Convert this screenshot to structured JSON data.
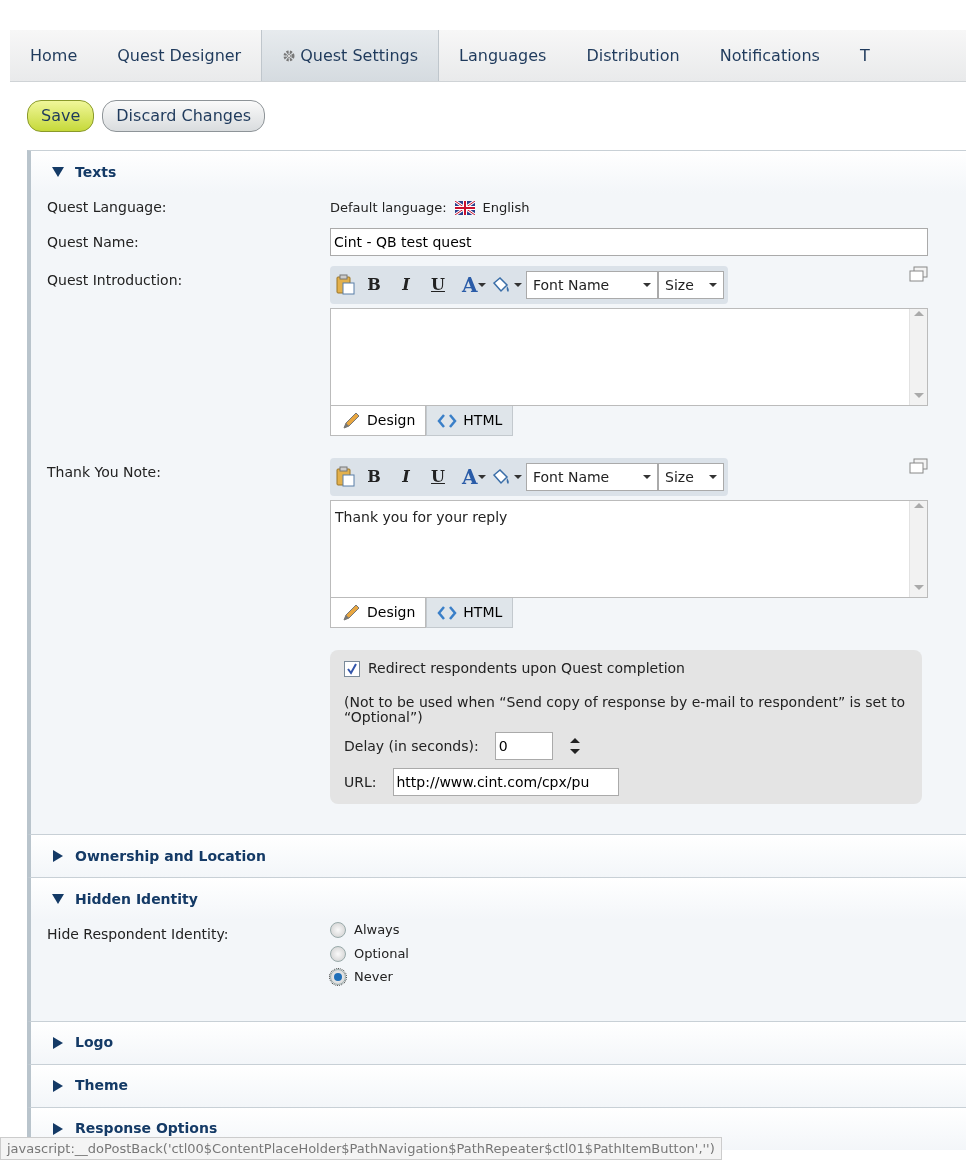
{
  "tabs": [
    {
      "label": "Home",
      "selected": false,
      "has_icon": false
    },
    {
      "label": "Quest Designer",
      "selected": false,
      "has_icon": false
    },
    {
      "label": "Quest Settings",
      "selected": true,
      "has_icon": true
    },
    {
      "label": "Languages",
      "selected": false,
      "has_icon": false
    },
    {
      "label": "Distribution",
      "selected": false,
      "has_icon": false
    },
    {
      "label": "Notifications",
      "selected": false,
      "has_icon": false
    },
    {
      "label": "T",
      "selected": false,
      "has_icon": false
    }
  ],
  "buttons": [
    {
      "label": "Save",
      "kind": "primary"
    },
    {
      "label": "Discard Changes",
      "kind": "secondary"
    }
  ],
  "sections": [
    {
      "title": "Texts",
      "expanded": true,
      "fields": [
        {
          "kind": "language",
          "label": "Quest Language:",
          "prefix": "Default language:",
          "language": "English"
        },
        {
          "kind": "text",
          "label": "Quest Name:",
          "value": "Cint - QB test quest"
        },
        {
          "kind": "editor",
          "label": "Quest Introduction:",
          "format_buttons": [
            {
              "label": "B",
              "kind": "bold"
            },
            {
              "label": "I",
              "kind": "italic"
            },
            {
              "label": "U",
              "kind": "underline"
            },
            {
              "label": "A",
              "kind": "color"
            }
          ],
          "font_name": "Font Name",
          "size": "Size",
          "modes": [
            {
              "label": "Design",
              "selected": true
            },
            {
              "label": "HTML",
              "selected": false
            }
          ]
        },
        {
          "kind": "editor",
          "label": "Thank You Note:",
          "format_buttons": [
            {
              "label": "B",
              "kind": "bold"
            },
            {
              "label": "I",
              "kind": "italic"
            },
            {
              "label": "U",
              "kind": "underline"
            },
            {
              "label": "A",
              "kind": "color"
            }
          ],
          "font_name": "Font Name",
          "size": "Size",
          "content": "Thank you for your reply",
          "modes": [
            {
              "label": "Design",
              "selected": true
            },
            {
              "label": "HTML",
              "selected": false
            }
          ]
        },
        {
          "kind": "redirect",
          "checked": true,
          "label": "Redirect respondents upon Quest completion",
          "note": "(Not to be used when “Send copy of response by e-mail to respondent” is set to “Optional”)",
          "delay_label": "Delay (in seconds):",
          "delay": "0",
          "url_label": "URL:",
          "url": "http://www.cint.com/cpx/pu"
        }
      ]
    },
    {
      "title": "Ownership and Location",
      "expanded": false
    },
    {
      "title": "Hidden Identity",
      "expanded": true,
      "fields": [
        {
          "kind": "radio",
          "label": "Hide Respondent Identity:",
          "options": [
            {
              "label": "Always",
              "selected": false
            },
            {
              "label": "Optional",
              "selected": false
            },
            {
              "label": "Never",
              "selected": true
            }
          ]
        }
      ]
    },
    {
      "title": "Logo",
      "expanded": false
    },
    {
      "title": "Theme",
      "expanded": false
    },
    {
      "title": "Response Options",
      "expanded": false
    }
  ],
  "status_text": "javascript:__doPostBack('ctl00$ContentPlaceHolder$PathNavigation$PathRepeater$ctl01$PathItemButton','')"
}
